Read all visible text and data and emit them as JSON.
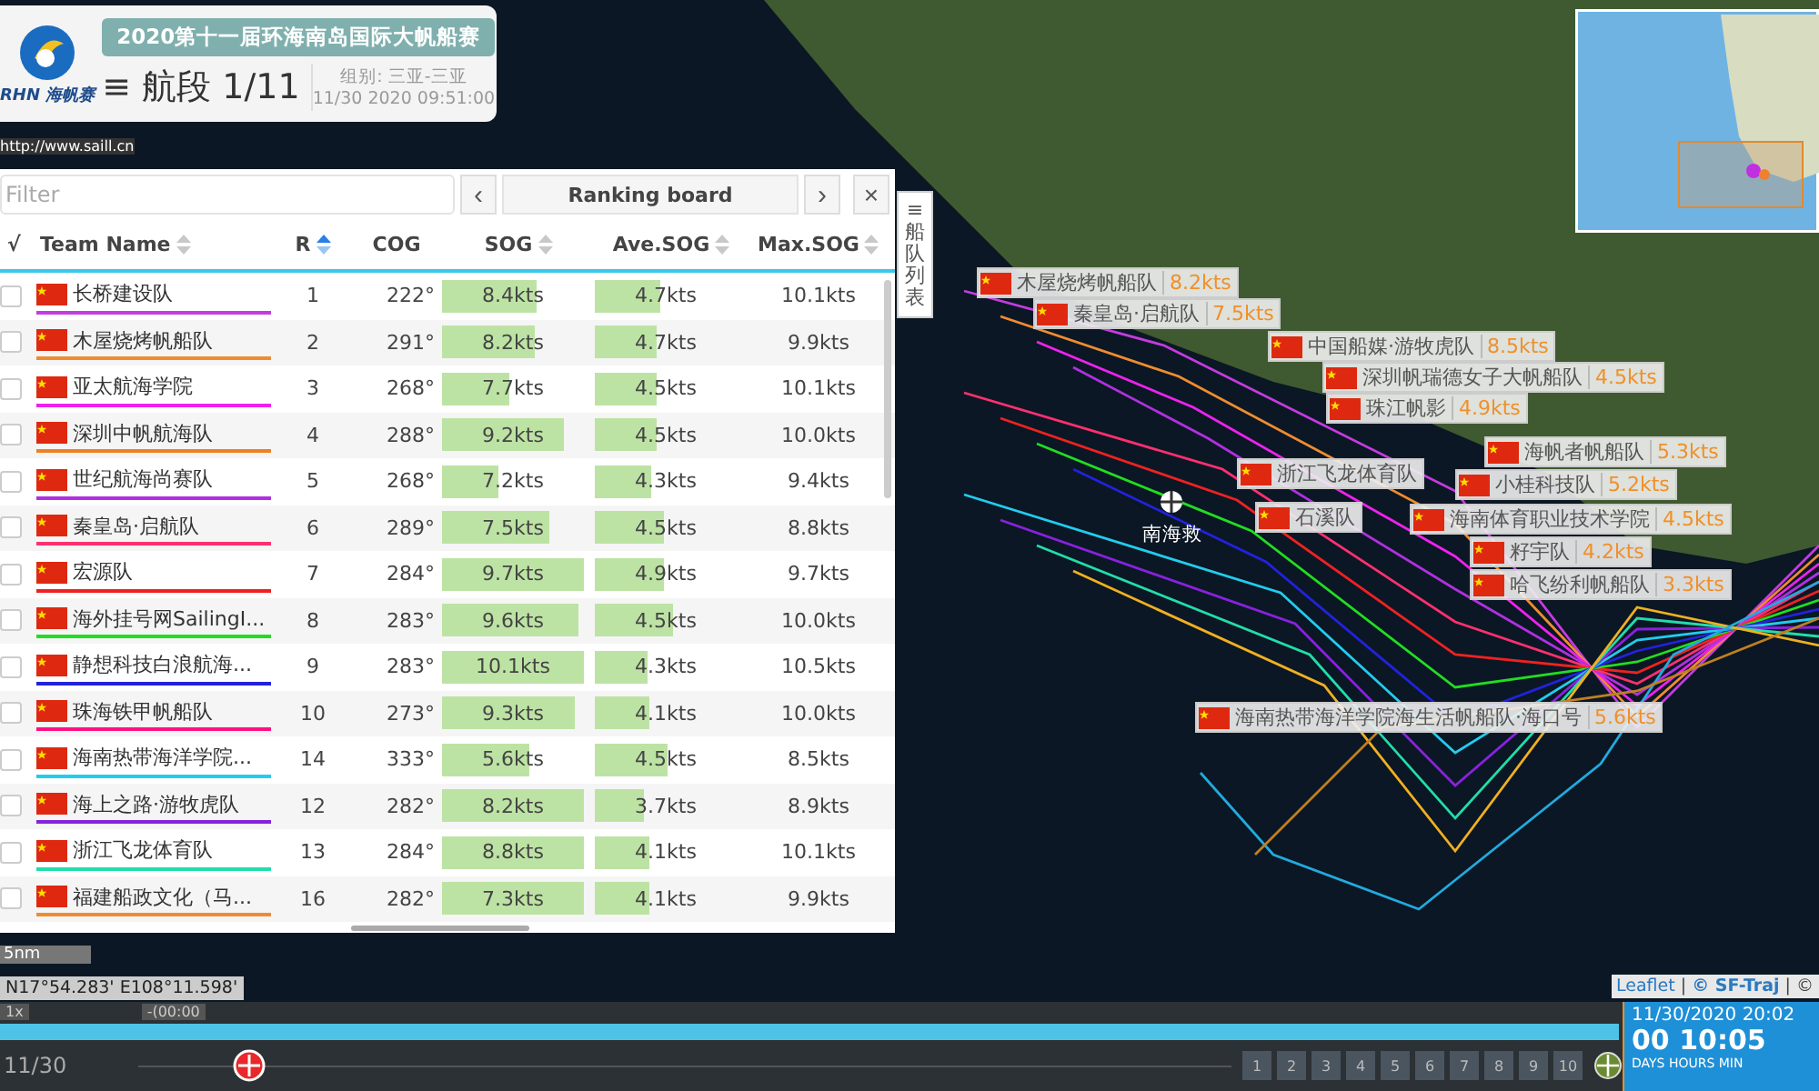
{
  "header": {
    "logo_text": "RHN 海帆赛",
    "title": "2020第十一届环海南岛国际大帆船赛",
    "leg": "≡ 航段 1/11",
    "group": "组别: 三亚-三亚",
    "time": "11/30 2020 09:51:00",
    "url": "http://www.saill.cn"
  },
  "ranking": {
    "filter_placeholder": "Filter",
    "prev": "‹",
    "title": "Ranking board",
    "next": "›",
    "close": "×",
    "side_tab": "≡船队列表",
    "columns": [
      {
        "label": "√"
      },
      {
        "label": "Team Name",
        "sorted": false
      },
      {
        "label": "R",
        "sorted": true
      },
      {
        "label": "COG"
      },
      {
        "label": "SOG",
        "sorted": false
      },
      {
        "label": "Ave.SOG",
        "sorted": false
      },
      {
        "label": "Max.SOG",
        "sorted": false
      }
    ],
    "rows": [
      {
        "checked": false,
        "name": "长桥建设队",
        "color": "#c43ce0",
        "r": "1",
        "cog": "222°",
        "sog": "8.4kts",
        "sog_level": {
          "level": 0.67
        },
        "ave": "4.7kts",
        "ave_level": {
          "level": 0.46
        },
        "max": "10.1kts"
      },
      {
        "checked": false,
        "name": "木屋烧烤帆船队",
        "color": "#f08c30",
        "r": "2",
        "cog": "291°",
        "sog": "8.2kts",
        "sog_level": {
          "level": 0.65
        },
        "ave": "4.7kts",
        "ave_level": {
          "level": 0.43
        },
        "max": "9.9kts"
      },
      {
        "checked": false,
        "name": "亚太航海学院",
        "color": "#ee22ee",
        "r": "3",
        "cog": "268°",
        "sog": "7.7kts",
        "sog_level": {
          "level": 0.47
        },
        "ave": "4.5kts",
        "ave_level": {
          "level": 0.43
        },
        "max": "10.1kts"
      },
      {
        "checked": false,
        "name": "深圳中帆航海队",
        "color": "#f08020",
        "r": "4",
        "cog": "288°",
        "sog": "9.2kts",
        "sog_level": {
          "level": 0.86
        },
        "ave": "4.5kts",
        "ave_level": {
          "level": 0.43
        },
        "max": "10.0kts"
      },
      {
        "checked": false,
        "name": "世纪航海尚赛队",
        "color": "#b030e0",
        "r": "5",
        "cog": "268°",
        "sog": "7.2kts",
        "sog_level": {
          "level": 0.4
        },
        "ave": "4.3kts",
        "ave_level": {
          "level": 0.4
        },
        "max": "9.4kts"
      },
      {
        "checked": false,
        "name": "秦皇岛·启航队",
        "color": "#ff3070",
        "r": "6",
        "cog": "289°",
        "sog": "7.5kts",
        "sog_level": {
          "level": 0.76
        },
        "ave": "4.5kts",
        "ave_level": {
          "level": 0.49
        },
        "max": "8.8kts"
      },
      {
        "checked": false,
        "name": "宏源队",
        "color": "#ee2222",
        "r": "7",
        "cog": "284°",
        "sog": "9.7kts",
        "sog_level": {
          "level": 1
        },
        "ave": "4.9kts",
        "ave_level": {
          "level": 0.49
        },
        "max": "9.7kts"
      },
      {
        "checked": false,
        "name": "海外挂号网SailingI...",
        "color": "#22dd22",
        "r": "8",
        "cog": "283°",
        "sog": "9.6kts",
        "sog_level": {
          "level": 0.96
        },
        "ave": "4.5kts",
        "ave_level": {
          "level": 0.55
        },
        "max": "10.0kts"
      },
      {
        "checked": false,
        "name": "静想科技白浪航海...",
        "color": "#2222dd",
        "r": "9",
        "cog": "283°",
        "sog": "10.1kts",
        "sog_level": {
          "level": 1
        },
        "ave": "4.3kts",
        "ave_level": {
          "level": 0.37
        },
        "max": "10.5kts"
      },
      {
        "checked": false,
        "name": "珠海铁甲帆船队",
        "color": "#ff1080",
        "r": "10",
        "cog": "273°",
        "sog": "9.3kts",
        "sog_level": {
          "level": 0.93
        },
        "ave": "4.1kts",
        "ave_level": {
          "level": 0.39
        },
        "max": "10.0kts"
      },
      {
        "checked": false,
        "name": "海南热带海洋学院...",
        "color": "#22ccee",
        "r": "14",
        "cog": "333°",
        "sog": "5.6kts",
        "sog_level": {
          "level": 0.61
        },
        "ave": "4.5kts",
        "ave_level": {
          "level": 0.51
        },
        "max": "8.5kts"
      },
      {
        "checked": false,
        "name": "海上之路·游牧虎队",
        "color": "#8822dd",
        "r": "12",
        "cog": "282°",
        "sog": "8.2kts",
        "sog_level": {
          "level": 1
        },
        "ave": "3.7kts",
        "ave_level": {
          "level": 0.34
        },
        "max": "8.9kts"
      },
      {
        "checked": false,
        "name": "浙江飞龙体育队",
        "color": "#22ddaa",
        "r": "13",
        "cog": "284°",
        "sog": "8.8kts",
        "sog_level": {
          "level": 1
        },
        "ave": "4.1kts",
        "ave_level": {
          "level": 0.39
        },
        "max": "10.1kts"
      },
      {
        "checked": false,
        "name": "福建船政文化（马...",
        "color": "#f08c30",
        "r": "16",
        "cog": "282°",
        "sog": "7.3kts",
        "sog_level": {
          "level": 1
        },
        "ave": "4.1kts",
        "ave_level": {
          "level": 0.39
        },
        "max": "9.9kts"
      }
    ]
  },
  "map_labels": [
    {
      "name": "木屋烧烤帆船队",
      "speed": "8.2kts"
    },
    {
      "name": "秦皇岛·启航队",
      "speed": "7.5kts"
    },
    {
      "name": "中国船媒·游牧虎队",
      "speed": "8.5kts"
    },
    {
      "name": "深圳帆瑞德女子大帆船队",
      "speed": "4.5kts"
    },
    {
      "name": "珠江帆影",
      "speed": "4.9kts"
    },
    {
      "name": "海帆者帆船队",
      "speed": "5.3kts"
    },
    {
      "name": "浙江飞龙体育队"
    },
    {
      "name": "小桂科技队",
      "speed": "5.2kts"
    },
    {
      "name": "石溪队"
    },
    {
      "name": "海南体育职业技术学院",
      "speed": "4.5kts"
    },
    {
      "name": "籽宇队",
      "speed": "4.2kts"
    },
    {
      "name": "哈飞纷利帆船队",
      "speed": "3.3kts"
    },
    {
      "name": "海南热带海洋学院海生活帆船队·海口号",
      "speed": "5.6kts"
    }
  ],
  "place_marker": {
    "label": "南海救"
  },
  "scale": "5nm",
  "coordinates": "N17°54.283'  E108°11.598'",
  "attribution": [
    {
      "text": "Leaflet",
      "kind": "link"
    },
    {
      "text": "|",
      "kind": "text"
    },
    {
      "text": "© SF-Traj",
      "kind": "link"
    },
    {
      "text": "| ©",
      "kind": "text"
    }
  ],
  "playback": {
    "speed": "1x",
    "offset": "-(00:00",
    "progress": {
      "level": 1
    },
    "date": "11/30",
    "position": {
      "level": 0.09
    },
    "pages": [
      {
        "label": "1",
        "selected": false
      },
      {
        "label": "2",
        "selected": false
      },
      {
        "label": "3",
        "selected": false
      },
      {
        "label": "4",
        "selected": false
      },
      {
        "label": "5",
        "selected": false
      },
      {
        "label": "6",
        "selected": false
      },
      {
        "label": "7",
        "selected": false
      },
      {
        "label": "8",
        "selected": false
      },
      {
        "label": "9",
        "selected": false
      },
      {
        "label": "10",
        "selected": false
      }
    ],
    "clock": {
      "datetime": "11/30/2020 20:02",
      "countdown": "00 10:05",
      "units": "DAYS HOURS MIN"
    }
  }
}
